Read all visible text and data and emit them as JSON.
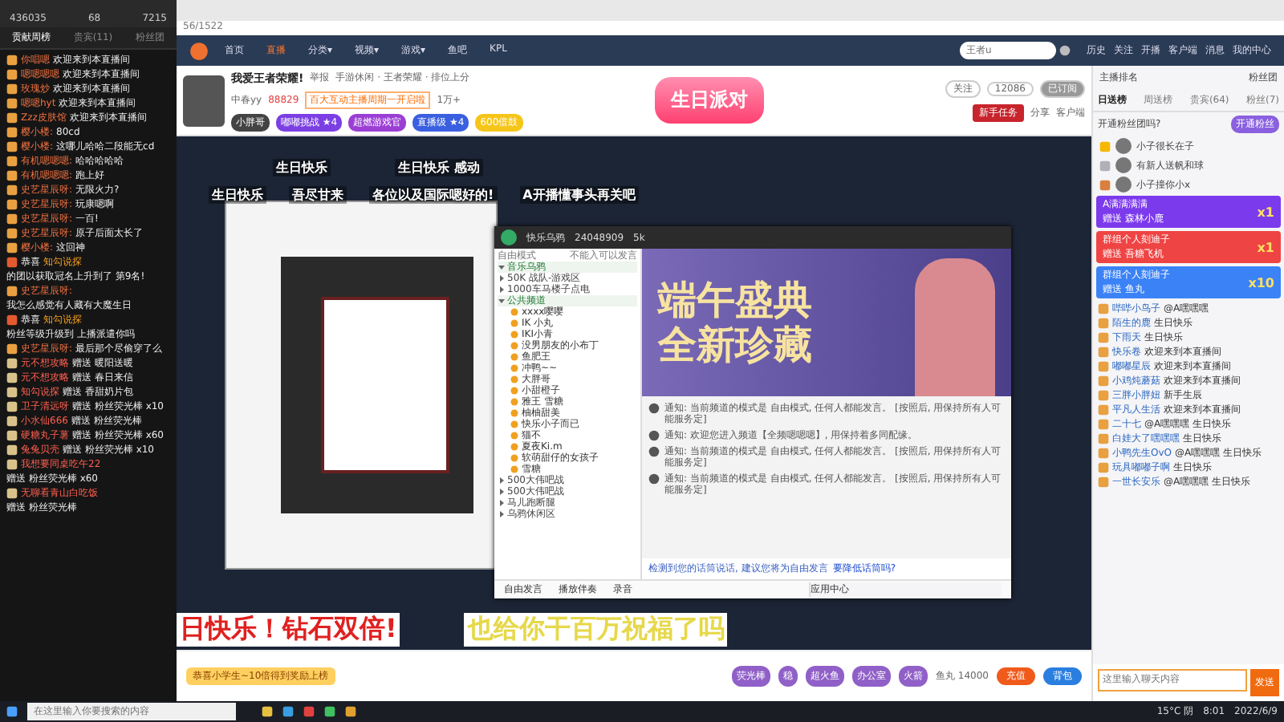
{
  "left_panel": {
    "stats": [
      "436035",
      "68",
      "7215"
    ],
    "tabs": [
      {
        "label": "贡献周榜",
        "selected": true
      },
      {
        "label": "贵宾(11)",
        "selected": false
      },
      {
        "label": "粉丝团",
        "selected": false
      }
    ],
    "messages": [
      {
        "kind": "chat",
        "user": "你唱嗯",
        "text": "欢迎来到本直播间"
      },
      {
        "kind": "chat",
        "user": "嗯嗯嗯嗯",
        "text": "欢迎来到本直播间"
      },
      {
        "kind": "chat",
        "user": "玫瑰炒",
        "text": "欢迎来到本直播间"
      },
      {
        "kind": "chat",
        "user": "嗯嗯hyt",
        "text": "欢迎来到本直播间"
      },
      {
        "kind": "chat",
        "user": "Zzz皮肤馆",
        "text": "欢迎来到本直播间"
      },
      {
        "kind": "chat",
        "user": "樱小楼:",
        "text": "80cd"
      },
      {
        "kind": "chat",
        "user": "樱小楼:",
        "text": "这哪儿哈哈二段能无cd"
      },
      {
        "kind": "chat",
        "user": "有机嗯嗯嗯:",
        "text": "哈哈哈哈哈"
      },
      {
        "kind": "chat",
        "user": "有机嗯嗯嗯:",
        "text": "跑上好"
      },
      {
        "kind": "chat",
        "user": "史艺星辰呀:",
        "text": "无限火力?"
      },
      {
        "kind": "chat",
        "user": "史艺星辰呀:",
        "text": "玩康嗯啊"
      },
      {
        "kind": "chat",
        "user": "史艺星辰呀:",
        "text": "一百!"
      },
      {
        "kind": "chat",
        "user": "史艺星辰呀:",
        "text": "原子后面太长了"
      },
      {
        "kind": "chat",
        "user": "樱小楼:",
        "text": "这回神"
      },
      {
        "kind": "system",
        "prefix": "恭喜",
        "user": "知勾说探",
        "text": "的团以获取冠名上升到了 第9名!"
      },
      {
        "kind": "chat",
        "user": "史艺星辰呀:",
        "text": "我怎么感觉有人藏有大魔生日"
      },
      {
        "kind": "system",
        "prefix": "恭喜",
        "user": "知勾说探",
        "text": "粉丝等级升级到 上播派遣你吗"
      },
      {
        "kind": "chat",
        "user": "史艺星辰呀:",
        "text": "最后那个尽偷穿了么"
      },
      {
        "kind": "gift",
        "user": "元不想攻略",
        "text": "赠送 暖阳送暖"
      },
      {
        "kind": "gift",
        "user": "元不想攻略",
        "text": "赠送 春日来信"
      },
      {
        "kind": "gift",
        "user": "知勾说探",
        "text": "赠送 香甜奶片包"
      },
      {
        "kind": "gift",
        "user": "卫子清远呀",
        "text": "赠送 粉丝荧光棒 x10"
      },
      {
        "kind": "gift",
        "user": "小水仙666",
        "text": "赠送 粉丝荧光棒"
      },
      {
        "kind": "gift",
        "user": "硬糖丸子薯",
        "text": "赠送 粉丝荧光棒 x60"
      },
      {
        "kind": "gift",
        "user": "兔兔贝壳",
        "text": "赠送 粉丝荧光棒 x10"
      },
      {
        "kind": "gift",
        "user": "我想要同桌吃午22",
        "text": "赠送 粉丝荧光棒 x60"
      },
      {
        "kind": "gift",
        "user": "无聊看青山白吃饭",
        "text": "赠送 粉丝荧光棒"
      }
    ]
  },
  "browser": {
    "url": "56/1522",
    "nav": [
      {
        "label": "首页",
        "selected": false
      },
      {
        "label": "直播",
        "selected": true
      },
      {
        "label": "分类▾",
        "selected": false
      },
      {
        "label": "视频▾",
        "selected": false
      },
      {
        "label": "游戏▾",
        "selected": false
      },
      {
        "label": "鱼吧",
        "selected": false
      },
      {
        "label": "KPL",
        "selected": false
      }
    ],
    "search": {
      "placeholder": "王者u"
    },
    "actions": [
      "历史",
      "关注",
      "开播",
      "客户端",
      "消息",
      "我的中心"
    ]
  },
  "stream": {
    "title": "我爱王者荣耀!",
    "report": "举报",
    "category": "手游休闲 · 王者荣耀 · 排位上分",
    "host": "中春yy",
    "heat": "88829",
    "notice": "百大互动主播周期一开启啦",
    "followers": "1万+",
    "badges": [
      {
        "label": "小胖哥",
        "color": "#444444"
      },
      {
        "label": "嘟嘟挑战 ★4",
        "color": "#7b3fe4"
      },
      {
        "label": "超燃游戏官",
        "color": "#9b3fd4"
      },
      {
        "label": "直播级 ★4",
        "color": "#3a5fe0"
      },
      {
        "label": "600倍鼓",
        "color": "#f5c518"
      }
    ],
    "event": "生日派对",
    "task_button": "新手任务",
    "share": "分享",
    "client": "客户端",
    "follow": "关注",
    "fans": "12086",
    "subscribe": "已订阅"
  },
  "video": {
    "danmaku_rows": [
      [
        {
          "text": "生日快乐",
          "color": "#ffffff"
        },
        {
          "text": "生日快乐 感动",
          "color": "#ffffff"
        }
      ],
      [
        {
          "text": "生日快乐",
          "color": "#ffffff"
        },
        {
          "text": "吾尽甘来",
          "color": "#ffffff"
        },
        {
          "text": "各位以及国际嗯好的!",
          "color": "#ffffff"
        },
        {
          "text": "A开播懂事头再关吧",
          "color": "#ffffff"
        }
      ],
      [
        {
          "text": "日快乐！钻石双倍!",
          "color": "#e02020"
        },
        {
          "text": "也给你干百万祝福了吗",
          "color": "#e6d84a"
        }
      ]
    ],
    "inner_app": {
      "title": "快乐乌鸦",
      "room_id": "24048909",
      "online": "5k",
      "mode": "自由模式",
      "hint": "不能入可以发言",
      "tree": [
        {
          "label": "音乐乌鸦",
          "expanded": true
        },
        {
          "label": "50K 战队-游戏区",
          "expanded": false
        },
        {
          "label": "1000车马楼子点电",
          "expanded": false
        },
        {
          "label": "公共频道",
          "expanded": true,
          "children": [
            {
              "label": "xxxx嘤嘤"
            },
            {
              "label": "IK 小丸"
            },
            {
              "label": "IKI小青"
            },
            {
              "label": "没男朋友的小布丁"
            },
            {
              "label": "鱼肥王"
            },
            {
              "label": "冲鸭~~"
            },
            {
              "label": "大胖哥"
            },
            {
              "label": "小甜橙子"
            },
            {
              "label": "雅王 雪糖"
            },
            {
              "label": "柚柚甜美"
            },
            {
              "label": "快乐小子而已"
            },
            {
              "label": "猫不"
            },
            {
              "label": "夏夜Ki.m"
            },
            {
              "label": "软萌甜仔的女孩子"
            },
            {
              "label": "雪糖"
            }
          ]
        },
        {
          "label": "500大伟吧战",
          "expanded": false
        },
        {
          "label": "500大伟吧战",
          "expanded": false
        },
        {
          "label": "马儿跑断腿",
          "expanded": false
        },
        {
          "label": "乌鸦休闲区",
          "expanded": false
        }
      ],
      "banner": [
        "端午盛典",
        "全新珍藏"
      ],
      "messages": [
        "通知: 当前频道的模式是 自由模式, 任何人都能发言。 [按照后, 用保持所有人可能服务定]",
        "通知: 欢迎您进入频道【全频嗯嗯嗯】, 用保持着多同配缘。",
        "通知: 当前频道的模式是 自由模式, 任何人都能发言。 [按照后, 用保持所有人可能服务定]",
        "通知: 当前频道的模式是 自由模式, 任何人都能发言。 [按照后, 用保持所有人可能服务定]"
      ],
      "tip": "检测到您的话筒说话, 建议您将为自由发言",
      "tip_link": "要降低话筒吗?",
      "toolbar": [
        "自由发言",
        "播放伴奏",
        "录音"
      ],
      "app_center": "应用中心"
    }
  },
  "right_panel": {
    "rank_title": "主播排名",
    "fans_title": "粉丝团",
    "tabs": [
      {
        "label": "日送榜",
        "selected": true
      },
      {
        "label": "周送榜",
        "selected": false
      },
      {
        "label": "贵宾(64)",
        "selected": false
      },
      {
        "label": "粉丝(7)",
        "selected": false
      }
    ],
    "top_hint": "开通粉丝团吗?",
    "top_button": "开通粉丝",
    "ranks": [
      {
        "name": "小子很长在子",
        "color": "#f5b800"
      },
      {
        "name": "有新人送帆和球",
        "color": "#b0b0b8"
      },
      {
        "name": "小子撞你小x",
        "color": "#d98040"
      }
    ],
    "banners": [
      {
        "name": "A满满满满",
        "sub": "赠送 森林小鹿",
        "count": "x1",
        "color": "#7c3aed"
      },
      {
        "name": "群组个人刻迪子",
        "sub": "赠送 吾糖飞机",
        "count": "x1",
        "color": "#ef4444"
      },
      {
        "name": "群组个人刻迪子",
        "sub": "赠送 鱼丸",
        "count": "x10",
        "color": "#3b82f6"
      }
    ],
    "messages": [
      {
        "user": "哔哔小鸟子",
        "text": "@A嘿嘿嘿"
      },
      {
        "user": "陌生的鹿",
        "text": "生日快乐"
      },
      {
        "user": "下雨天",
        "text": "生日快乐"
      },
      {
        "user": "快乐卷",
        "text": "欢迎来到本直播间"
      },
      {
        "user": "嘟嘟星辰",
        "text": "欢迎来到本直播间"
      },
      {
        "user": "小鸡炖蘑菇",
        "text": "欢迎来到本直播间"
      },
      {
        "user": "三胖小胖妞",
        "text": "新手生辰"
      },
      {
        "user": "平凡人生活",
        "text": "欢迎来到本直播间"
      },
      {
        "user": "二十七",
        "text": "@A嘿嘿嘿 生日快乐"
      },
      {
        "user": "白娃大了嘿嘿嘿",
        "text": "生日快乐"
      },
      {
        "user": "小鸭先生OvO",
        "text": "@A嘿嘿嘿 生日快乐"
      },
      {
        "user": "玩具嘟嘟子啊",
        "text": "生日快乐"
      },
      {
        "user": "一世长安乐",
        "text": "@A嘿嘿嘿 生日快乐"
      }
    ],
    "input_placeholder": "这里输入聊天内容",
    "send": "发送"
  },
  "gift_bar": {
    "gifts": [
      "荧光棒",
      "稳",
      "超火鱼",
      "办公室",
      "火箭"
    ],
    "balance": "鱼丸 14000",
    "recharge": "充值",
    "bag": "背包",
    "notice": "恭喜小学生~10倍得到奖励上榜"
  },
  "taskbar": {
    "search_placeholder": "在这里输入你要搜索的内容",
    "weather": "15°C 阴",
    "time": "8:01",
    "date": "2022/6/9"
  }
}
